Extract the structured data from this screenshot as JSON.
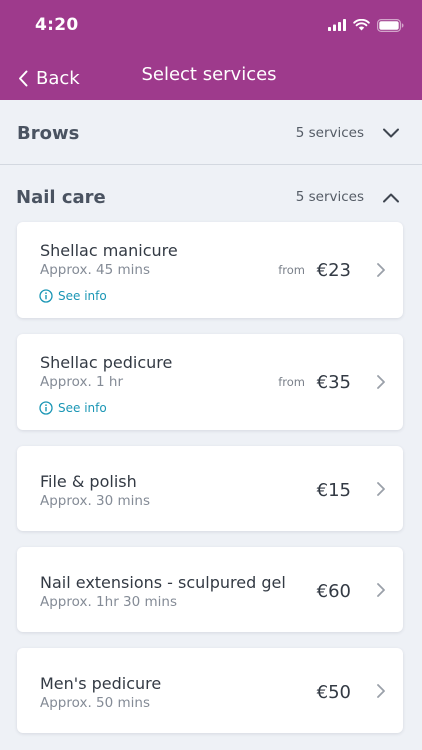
{
  "status_bar": {
    "time": "4:20"
  },
  "nav": {
    "back_label": "Back",
    "title": "Select services"
  },
  "categories": [
    {
      "name": "Brows",
      "count": "5 services",
      "expanded": false
    },
    {
      "name": "Nail care",
      "count": "5 services",
      "expanded": true
    }
  ],
  "services": [
    {
      "name": "Shellac manicure",
      "duration": "Approx. 45 mins",
      "price_prefix": "from",
      "price": "€23",
      "info_label": "See info"
    },
    {
      "name": "Shellac pedicure",
      "duration": "Approx. 1 hr",
      "price_prefix": "from",
      "price": "€35",
      "info_label": "See info"
    },
    {
      "name": "File & polish",
      "duration": "Approx. 30 mins",
      "price": "€15"
    },
    {
      "name": "Nail extensions - sculpured gel",
      "duration": "Approx. 1hr 30 mins",
      "price": "€60"
    },
    {
      "name": "Men's pedicure",
      "duration": "Approx. 50 mins",
      "price": "€50"
    }
  ],
  "colors": {
    "header": "#9e3a8c",
    "link": "#1a96b5",
    "background": "#eef1f6"
  }
}
